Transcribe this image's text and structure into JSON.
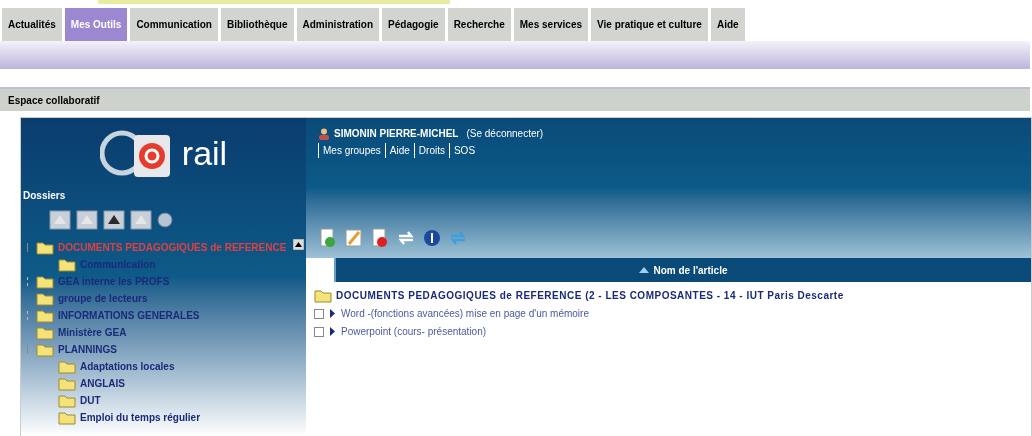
{
  "tabs": [
    {
      "label": "Actualités",
      "selected": false
    },
    {
      "label": "Mes Outils",
      "selected": true
    },
    {
      "label": "Communication",
      "selected": false
    },
    {
      "label": "Bibliothèque",
      "selected": false
    },
    {
      "label": "Administration",
      "selected": false
    },
    {
      "label": "Pédagogie",
      "selected": false
    },
    {
      "label": "Recherche",
      "selected": false
    },
    {
      "label": "Mes services",
      "selected": false
    },
    {
      "label": "Vie pratique et culture",
      "selected": false
    },
    {
      "label": "Aide",
      "selected": false
    }
  ],
  "section_title": "Espace collaboratif",
  "sidebar": {
    "logo": "rail",
    "heading": "Dossiers",
    "tree": [
      {
        "label": "DOCUMENTS PEDAGOGIQUES de REFERENCE",
        "selected": true,
        "expanded": true,
        "children": [
          {
            "label": "Communication",
            "selected": false
          }
        ]
      },
      {
        "label": "GEA interne les PROFS",
        "selected": false,
        "expanded": false
      },
      {
        "label": "groupe de lecteurs",
        "selected": false
      },
      {
        "label": "INFORMATIONS GENERALES",
        "selected": false,
        "expanded": false
      },
      {
        "label": "Ministère GEA",
        "selected": false
      },
      {
        "label": "PLANNINGS",
        "selected": false,
        "expanded": true,
        "children": [
          {
            "label": "Adaptations locales",
            "selected": false
          },
          {
            "label": "ANGLAIS",
            "selected": false
          },
          {
            "label": "DUT",
            "selected": false
          },
          {
            "label": "Emploi du temps régulier",
            "selected": false
          }
        ]
      }
    ]
  },
  "user": {
    "name": "SIMONIN PIERRE-MICHEL",
    "logout": "(Se déconnecter)",
    "links": [
      "Mes groupes",
      "Aide",
      "Droits",
      "SOS"
    ]
  },
  "table": {
    "column": "Nom de l'article",
    "rows": [
      {
        "kind": "folder",
        "label": "DOCUMENTS PEDAGOGIQUES de REFERENCE (2 - LES COMPOSANTES - 14 - IUT Paris Descarte"
      },
      {
        "kind": "file",
        "label": "Word -(fonctions avancées) mise en page d'un mémoire",
        "checked": false
      },
      {
        "kind": "file",
        "label": "Powerpoint (cours- présentation)",
        "checked": false
      }
    ]
  }
}
